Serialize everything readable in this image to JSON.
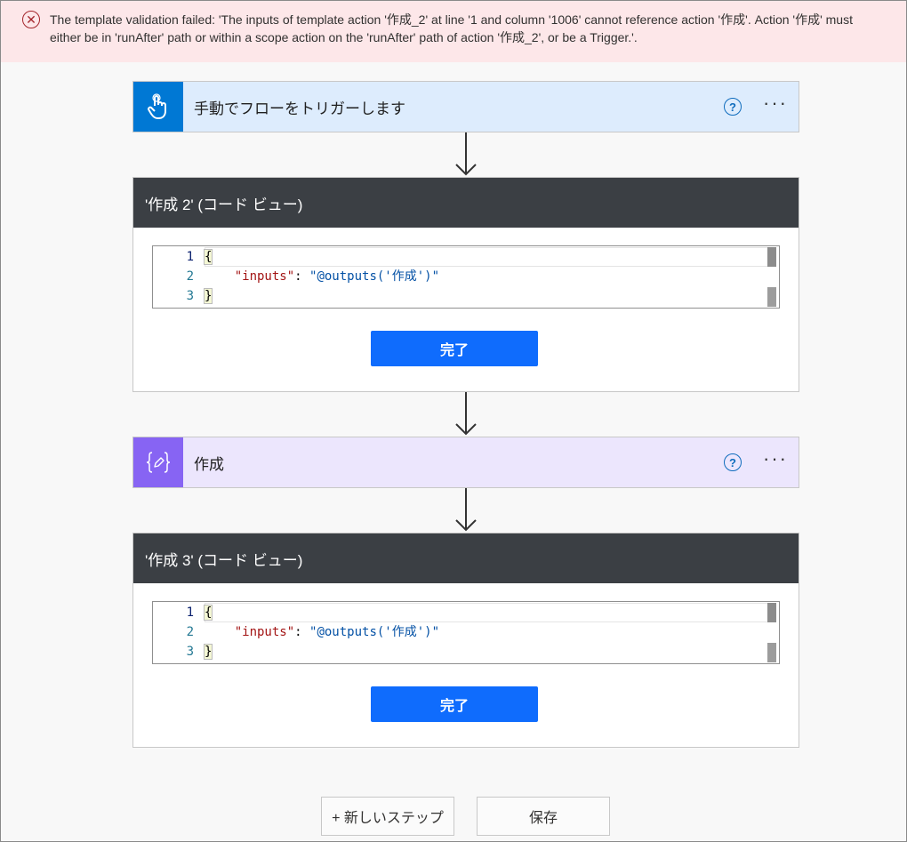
{
  "error": {
    "icon": "error-circle-x-icon",
    "message": "The template validation failed: 'The inputs of template action '作成_2' at line '1 and column '1006' cannot reference action '作成'. Action '作成' must either be in 'runAfter' path or within a scope action on the 'runAfter' path of action '作成_2', or be a Trigger.'."
  },
  "trigger": {
    "title": "手動でフローをトリガーします",
    "icon": "touch-hand-icon",
    "color": "#0078d4",
    "help": "?",
    "more": "···"
  },
  "code_card_1": {
    "title": "'作成 2' (コード ビュー)",
    "lines": [
      {
        "num": "1",
        "text": "{"
      },
      {
        "num": "2",
        "key": "\"inputs\"",
        "sep": ": ",
        "value": "\"@outputs('作成')\""
      },
      {
        "num": "3",
        "text": "}"
      }
    ],
    "done": "完了"
  },
  "compose": {
    "title": "作成",
    "icon": "compose-braces-icon",
    "color": "#8764f3",
    "help": "?",
    "more": "···"
  },
  "code_card_2": {
    "title": "'作成 3' (コード ビュー)",
    "lines": [
      {
        "num": "1",
        "text": "{"
      },
      {
        "num": "2",
        "key": "\"inputs\"",
        "sep": ": ",
        "value": "\"@outputs('作成')\""
      },
      {
        "num": "3",
        "text": "}"
      }
    ],
    "done": "完了"
  },
  "footer": {
    "new_step": "+ 新しいステップ",
    "save": "保存"
  }
}
